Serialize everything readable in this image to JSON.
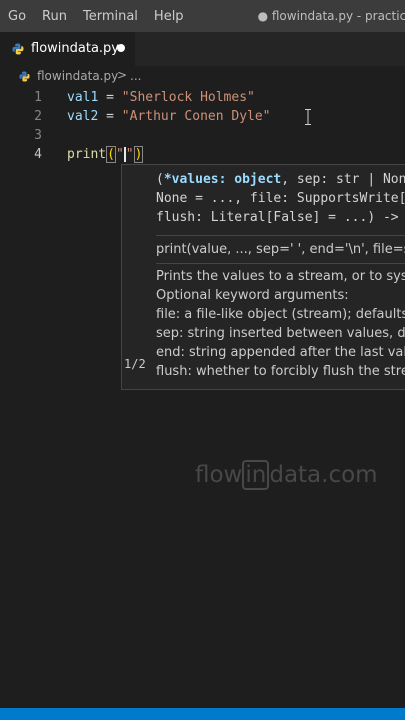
{
  "menubar": {
    "items": [
      "Go",
      "Run",
      "Terminal",
      "Help"
    ],
    "window_title": "● flowindata.py - practice_code"
  },
  "tab": {
    "filename": "flowindata.py",
    "icon": "python-icon"
  },
  "breadcrumb": {
    "file": "flowindata.py",
    "separator": ">",
    "more": "..."
  },
  "editor": {
    "lines": [
      {
        "number": "1",
        "var": "val1",
        "op": " = ",
        "value": "\"Sherlock Holmes\""
      },
      {
        "number": "2",
        "var": "val2",
        "op": " = ",
        "value": "\"Arthur Conen Dyle\""
      },
      {
        "number": "3"
      },
      {
        "number": "4",
        "fn": "print",
        "open": "(",
        "quote_open": "\"",
        "quote_close": "\"",
        "close": ")"
      }
    ]
  },
  "hover": {
    "sig_open": "(",
    "sig_param": "*values: object",
    "sig_rest1": ", sep: str | None",
    "sig_line2": "None = ..., file: SupportsWrite[s",
    "sig_line3": "flush: Literal[False] = ...) -> N",
    "overload": "1/2",
    "call": "print(value, ..., sep=' ', end='\\n', file=sys.s",
    "doc_lines": [
      "Prints the values to a stream, or to sys.std",
      "Optional keyword arguments:",
      "file: a file-like object (stream); defaults to",
      "sep: string inserted between values, defa",
      "end: string appended after the last value",
      "flush: whether to forcibly flush the strean"
    ]
  },
  "watermark": {
    "pre": "flow",
    "mid": "in",
    "post": "data.com"
  },
  "colors": {
    "accent": "#007acc",
    "string": "#ce9178",
    "variable": "#9cdcfe",
    "function": "#dcdcaa"
  }
}
